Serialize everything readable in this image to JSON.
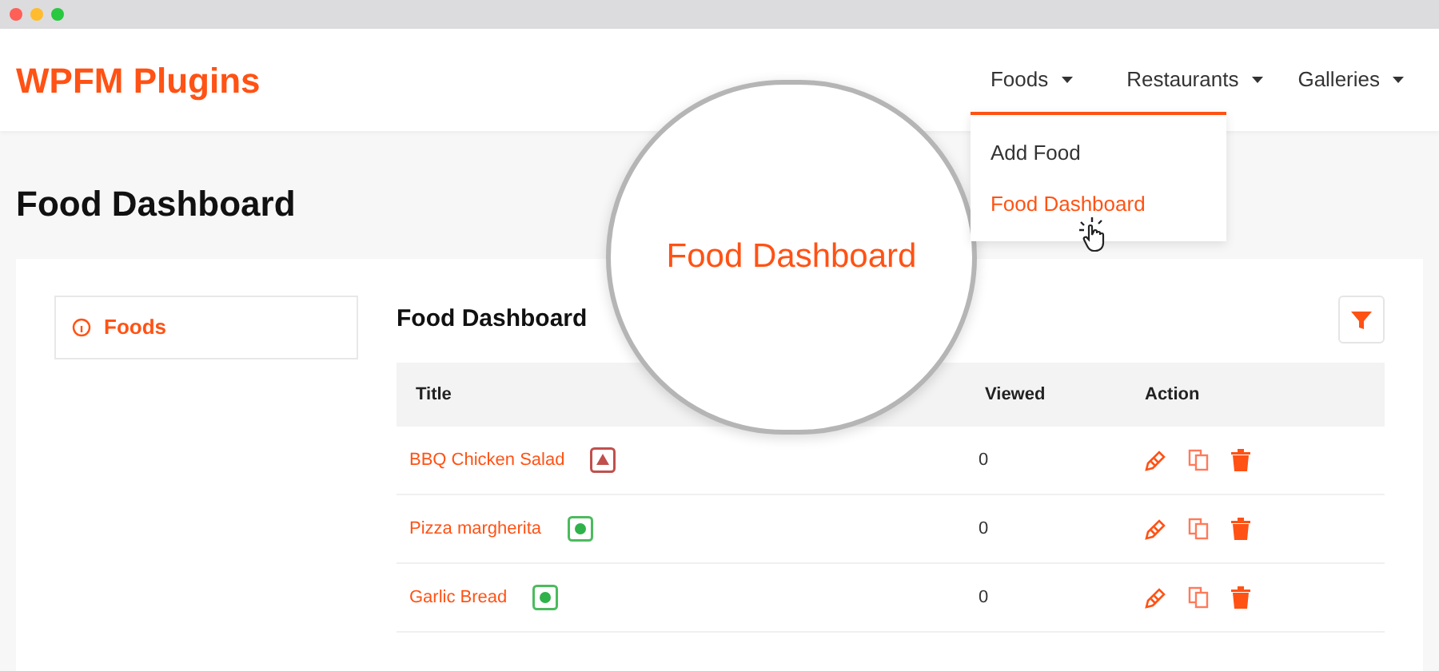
{
  "browser": {
    "dots": [
      {
        "color": "#fe5f57"
      },
      {
        "color": "#febc2e"
      },
      {
        "color": "#28c840"
      }
    ]
  },
  "header": {
    "logo": "WPFM Plugins",
    "nav": [
      {
        "label": "Foods",
        "expanded": true,
        "menu": [
          {
            "label": "Add Food",
            "selected": false
          },
          {
            "label": "Food Dashboard",
            "selected": true
          }
        ]
      },
      {
        "label": "Restaurants",
        "expanded": false
      },
      {
        "label": "Galleries",
        "expanded": false
      }
    ]
  },
  "page_title": "Food Dashboard",
  "magnifier": {
    "text": "Food Dashboard"
  },
  "sidebar": {
    "items": [
      {
        "label": "Foods",
        "selected": true
      }
    ]
  },
  "panel": {
    "title": "Food Dashboard",
    "table": {
      "columns": [
        "Title",
        "Viewed",
        "Action"
      ],
      "rows": [
        {
          "title": "BBQ Chicken Salad",
          "kind": "non-veg",
          "viewed": "0"
        },
        {
          "title": "Pizza margherita",
          "kind": "veg",
          "viewed": "0"
        },
        {
          "title": "Garlic Bread",
          "kind": "veg",
          "viewed": "0"
        }
      ]
    }
  }
}
